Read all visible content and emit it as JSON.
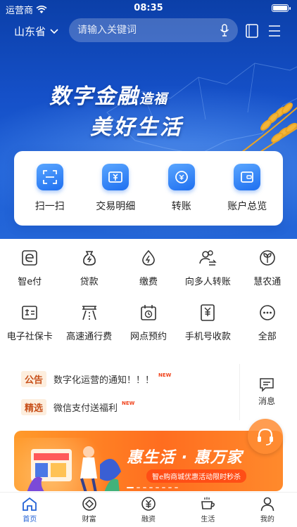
{
  "status_bar": {
    "carrier": "运营商",
    "time": "08:35"
  },
  "top_bar": {
    "region": "山东省",
    "search_placeholder": "请输入关键词"
  },
  "banner": {
    "line1_main": "数字金融",
    "line1_small": "造福",
    "line2": "美好生活"
  },
  "quick_actions": [
    {
      "label": "扫一扫",
      "icon": "scan-icon"
    },
    {
      "label": "交易明细",
      "icon": "yuan-card-icon"
    },
    {
      "label": "转账",
      "icon": "transfer-icon"
    },
    {
      "label": "账户总览",
      "icon": "wallet-icon"
    }
  ],
  "services": [
    [
      {
        "label": "智e付",
        "icon": "e-pay-icon"
      },
      {
        "label": "贷款",
        "icon": "money-bag-icon"
      },
      {
        "label": "缴费",
        "icon": "lightning-drop-icon"
      },
      {
        "label": "向多人转账",
        "icon": "multi-user-transfer-icon"
      },
      {
        "label": "慧农通",
        "icon": "sprout-icon"
      }
    ],
    [
      {
        "label": "电子社保卡",
        "icon": "social-card-icon"
      },
      {
        "label": "高速通行费",
        "icon": "highway-icon"
      },
      {
        "label": "网点预约",
        "icon": "calendar-clock-icon"
      },
      {
        "label": "手机号收款",
        "icon": "phone-yuan-icon"
      },
      {
        "label": "全部",
        "icon": "more-dots-icon"
      }
    ]
  ],
  "notices": [
    {
      "tag": "公告",
      "text": "数字化运营的通知！！！",
      "badge": "NEW"
    },
    {
      "tag": "精选",
      "text": "微信支付送福利",
      "badge": "NEW"
    }
  ],
  "messages": {
    "label": "消息"
  },
  "promo": {
    "title": "惠生活 · 惠万家",
    "subtitle": "智e购商城优惠活动限时秒杀"
  },
  "tabs": [
    {
      "label": "首页",
      "icon": "home-icon",
      "active": true
    },
    {
      "label": "财富",
      "icon": "wealth-icon",
      "active": false
    },
    {
      "label": "融资",
      "icon": "yuan-circle-icon",
      "active": false
    },
    {
      "label": "生活",
      "icon": "coffee-icon",
      "active": false
    },
    {
      "label": "我的",
      "icon": "user-icon",
      "active": false
    }
  ],
  "colors": {
    "primary": "#2463d6",
    "hero_dark": "#0b3fa8",
    "promo_orange": "#ff6d1f",
    "tag_text": "#c8501a"
  }
}
